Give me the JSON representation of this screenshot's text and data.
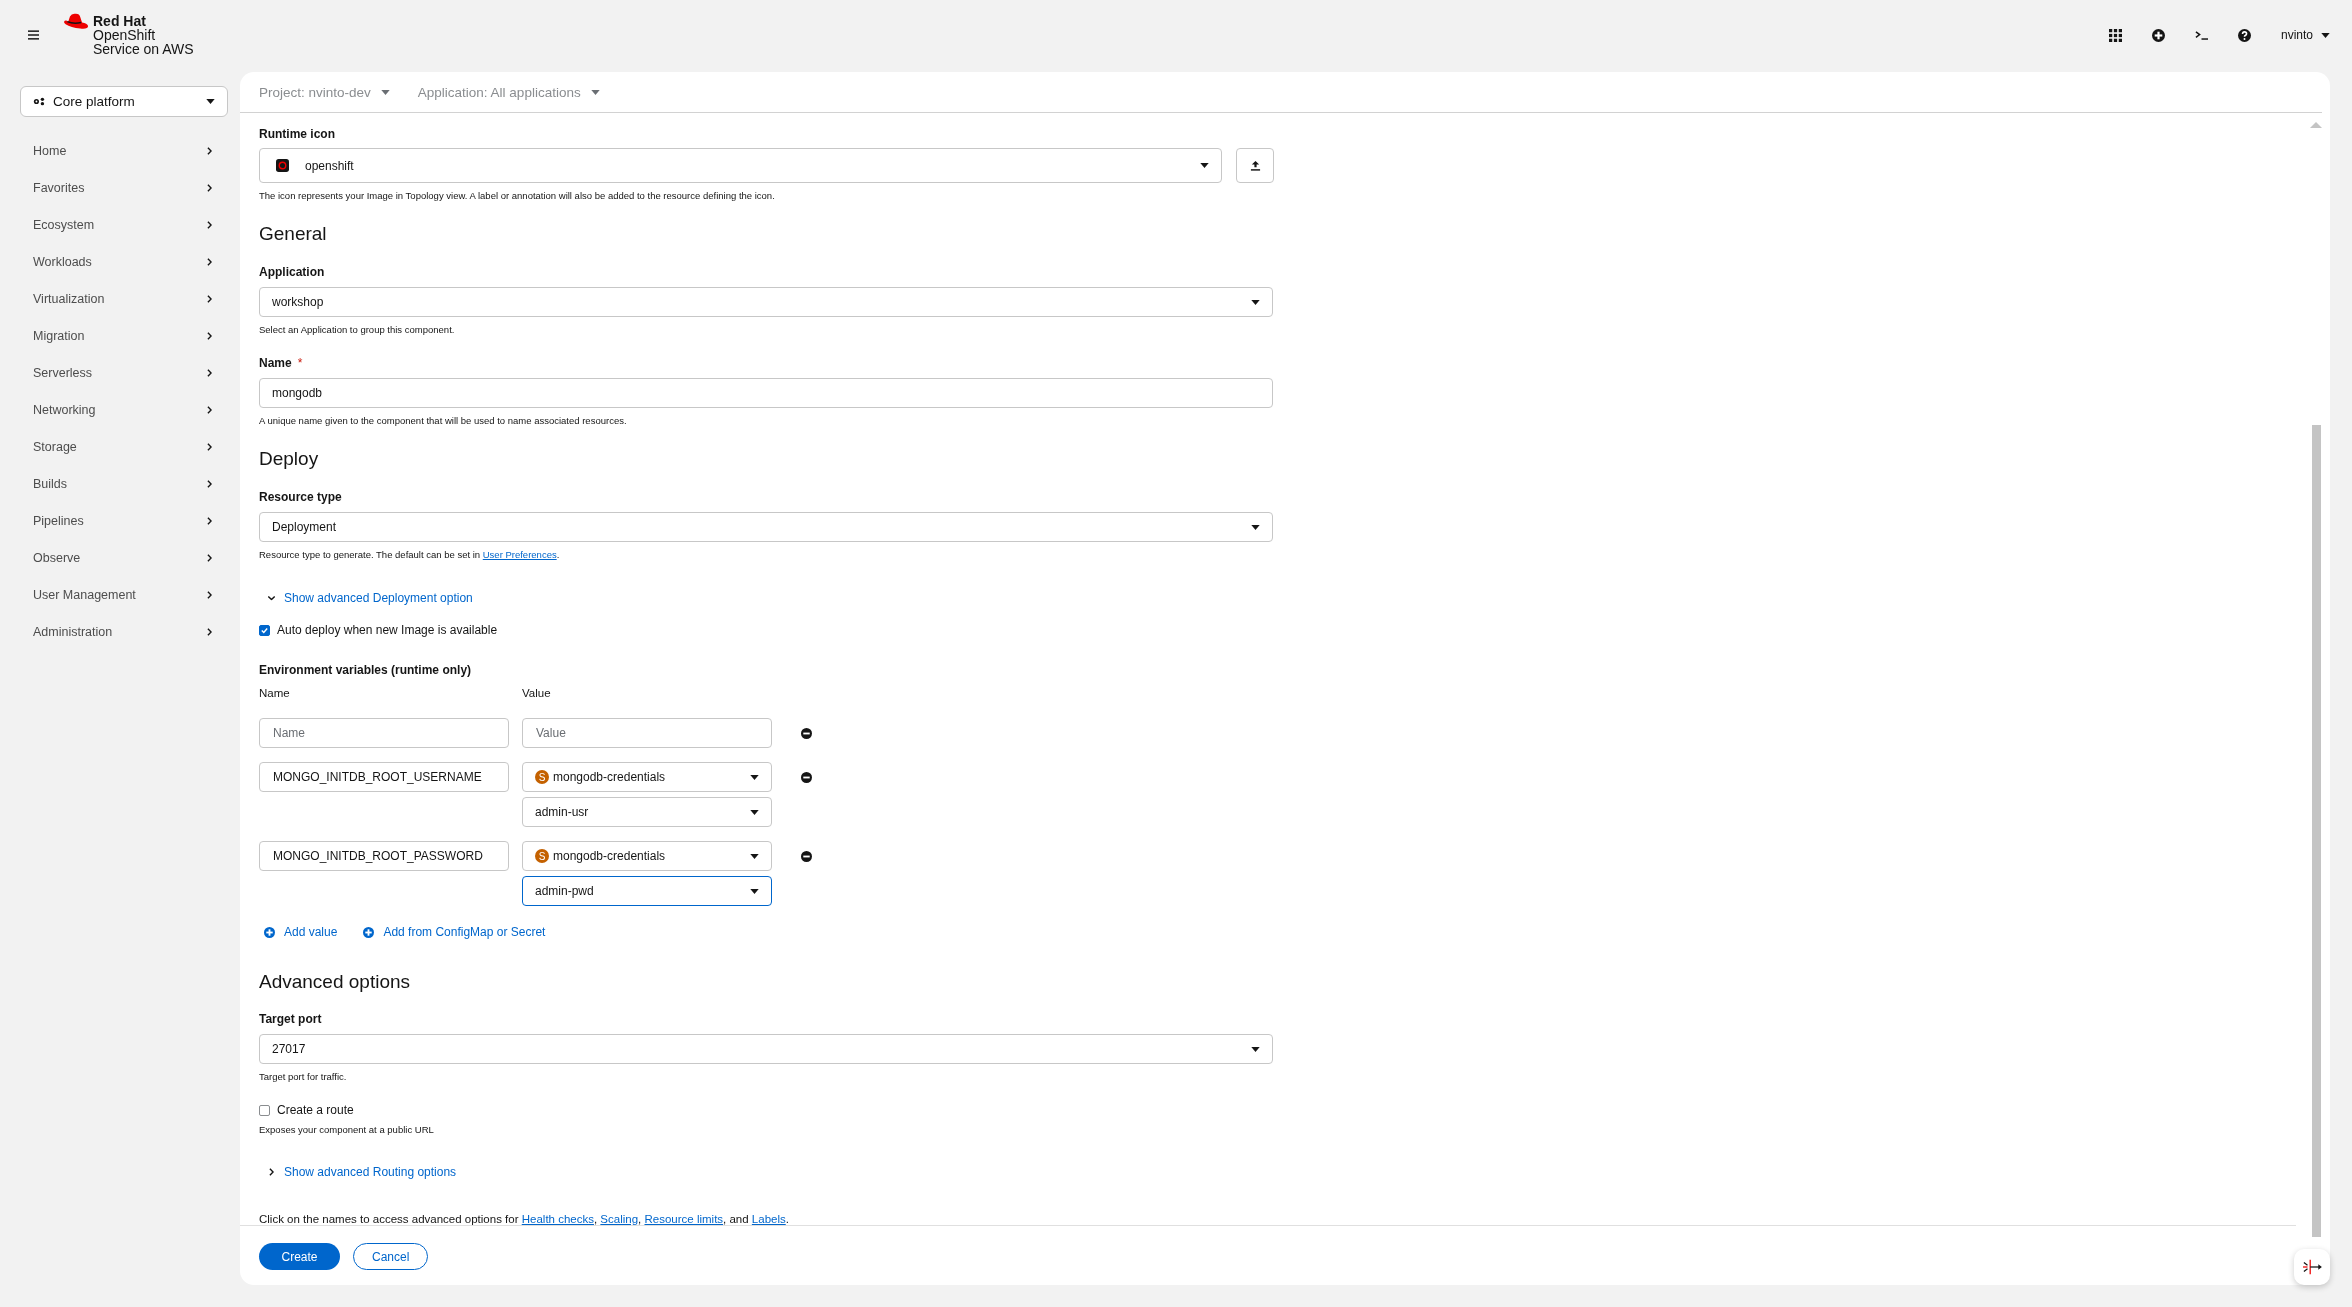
{
  "masthead": {
    "brand": [
      "Red Hat",
      "OpenShift",
      "Service on AWS"
    ],
    "user": "nvinto"
  },
  "perspective": "Core platform",
  "nav": [
    {
      "label": "Home"
    },
    {
      "label": "Favorites"
    },
    {
      "label": "Ecosystem"
    },
    {
      "label": "Workloads"
    },
    {
      "label": "Virtualization"
    },
    {
      "label": "Migration"
    },
    {
      "label": "Serverless"
    },
    {
      "label": "Networking"
    },
    {
      "label": "Storage"
    },
    {
      "label": "Builds"
    },
    {
      "label": "Pipelines"
    },
    {
      "label": "Observe"
    },
    {
      "label": "User Management"
    },
    {
      "label": "Administration"
    }
  ],
  "context_bar": [
    "Project: nvinto-dev",
    "Application: All applications"
  ],
  "runtime_icon": {
    "label": "Runtime icon",
    "value": "openshift",
    "help": "The icon represents your Image in Topology view. A label or annotation will also be added to the resource defining the icon."
  },
  "general": {
    "title": "General",
    "application": {
      "label": "Application",
      "value": "workshop",
      "help": "Select an Application to group this component."
    },
    "name": {
      "label": "Name",
      "required_mark": "*",
      "value": "mongodb",
      "help": "A unique name given to the component that will be used to name associated resources."
    }
  },
  "deploy": {
    "title": "Deploy",
    "resource_type": {
      "label": "Resource type",
      "value": "Deployment",
      "help": "Resource type to generate. The default can be set in ",
      "help_link": "User Preferences",
      "help_end": "."
    },
    "advanced_toggle": {
      "label": "Show advanced Deployment option",
      "expanded": true
    },
    "auto_deploy": {
      "label": "Auto deploy when new Image is available",
      "checked": true
    }
  },
  "env": {
    "title": "Environment variables (runtime only)",
    "name_header": "Name",
    "value_header": "Value",
    "rows": [
      {
        "kind": "plain",
        "name_placeholder": "Name",
        "value_placeholder": "Value"
      },
      {
        "kind": "secret",
        "name": "MONGO_INITDB_ROOT_USERNAME",
        "badge": "S",
        "secret": "mongodb-credentials",
        "key": "admin-usr",
        "focused": false
      },
      {
        "kind": "secret",
        "name": "MONGO_INITDB_ROOT_PASSWORD",
        "badge": "S",
        "secret": "mongodb-credentials",
        "key": "admin-pwd",
        "focused": true
      }
    ],
    "add_links": [
      "Add value",
      "Add from ConfigMap or Secret"
    ]
  },
  "advanced": {
    "title": "Advanced options",
    "target_port": {
      "label": "Target port",
      "value": "27017",
      "help": "Target port for traffic."
    },
    "route": {
      "label": "Create a route",
      "checked": false,
      "help": "Exposes your component at a public URL"
    },
    "routing_toggle": {
      "label": "Show advanced Routing options",
      "expanded": false
    },
    "note": [
      {
        "text": "Click on the names to access advanced options for "
      },
      {
        "link": "Health checks"
      },
      {
        "text": ", "
      },
      {
        "link": "Scaling"
      },
      {
        "text": ", "
      },
      {
        "link": "Resource limits"
      },
      {
        "text": ", and "
      },
      {
        "link": "Labels"
      },
      {
        "text": "."
      }
    ]
  },
  "actions": [
    {
      "label": "Create",
      "primary": true
    },
    {
      "label": "Cancel",
      "primary": false
    }
  ]
}
